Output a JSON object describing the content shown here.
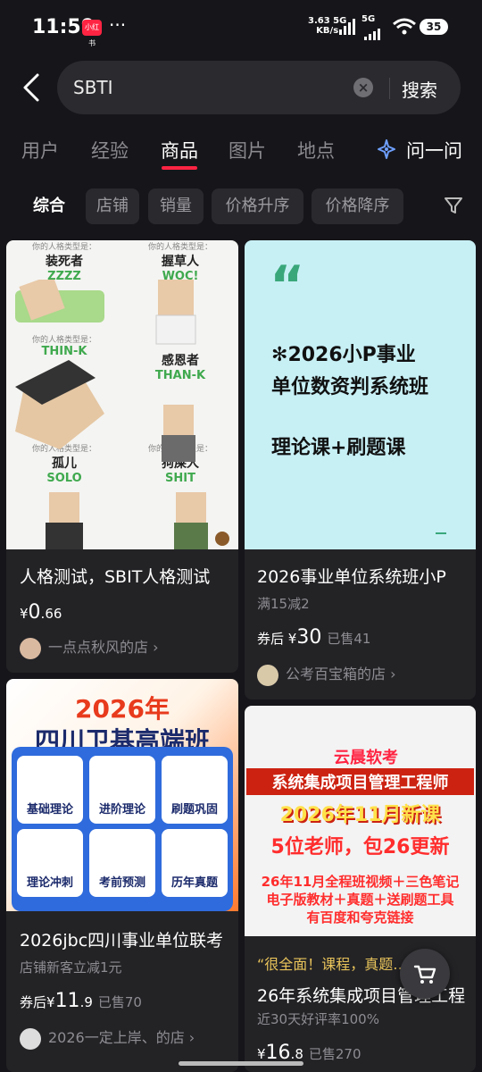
{
  "status_bar": {
    "time": "11:59",
    "app_badge": "小红书",
    "more": "···",
    "net_speed": "3.63",
    "net_unit": "KB/s",
    "signal1": "5G",
    "signal2": "5G",
    "battery": "35"
  },
  "search": {
    "query": "SBTI",
    "clear_label": "×",
    "button_label": "搜索"
  },
  "tabs": [
    "用户",
    "经验",
    "商品",
    "图片",
    "地点"
  ],
  "active_tab": "商品",
  "ask": {
    "label": "问一问"
  },
  "filters": [
    "综合",
    "店铺",
    "销量",
    "价格升序",
    "价格降序"
  ],
  "products": [
    {
      "title": "人格测试，SBIT人格测试",
      "price_prefix": "¥",
      "price_int": "0",
      "price_dec": ".66",
      "shop": "一点点秋风的店 ›",
      "art": {
        "cells": [
          {
            "top": "你的人格类型是：",
            "name": "装死者",
            "code": "ZZZZ"
          },
          {
            "top": "你的人格类型是：",
            "name": "握草人",
            "code": "WOC!"
          },
          {
            "top": "你的人格类型是：",
            "name": "",
            "code": "THIN-K"
          },
          {
            "top": "",
            "name": "感恩者",
            "code": "THAN-K"
          },
          {
            "top": "你的人格类型是：",
            "name": "孤儿",
            "code": "SOLO"
          },
          {
            "top": "你的人格类型是：",
            "name": "狗屎人",
            "code": "SHIT"
          }
        ]
      }
    },
    {
      "title": "2026事业单位系统班小P",
      "promo": "满15减2",
      "price_label": "券后",
      "price_prefix": "¥",
      "price_int": "30",
      "sold": "已售41",
      "shop": "公考百宝箱的店 ›",
      "art": {
        "quote": "“",
        "line1": "2026小P事业",
        "line2": "单位数资判系统班",
        "line3": "理论课+刷题课"
      }
    },
    {
      "title": "2026jbc四川事业单位联考",
      "promo": "店铺新客立减1元",
      "price_label": "券后",
      "price_prefix": "¥",
      "price_int": "11",
      "price_dec": ".9",
      "sold": "已售70",
      "shop": "2026一定上岸、的店 ›",
      "art": {
        "year": "2026年",
        "heading": "四川卫基高端班",
        "tiles": [
          "基础理论",
          "进阶理论",
          "刷题巩固",
          "理论冲刺",
          "考前预测",
          "历年真题"
        ]
      }
    },
    {
      "review": "“很全面！课程，真题…”",
      "title": "26年系统集成项目管理工程",
      "promo": "近30天好评率100%",
      "price_prefix": "¥",
      "price_int": "16",
      "price_dec": ".8",
      "sold": "已售270",
      "art": {
        "brand": "云晨软考",
        "line1": "系统集成项目管理工程师",
        "line2": "2026年11月新课",
        "line3": "5位老师，包26更新",
        "line4": "26年11月全程班视频＋三色笔记",
        "line5": "电子版教材＋真题＋送刷题工具",
        "line6": "有百度和夸克链接"
      }
    }
  ]
}
